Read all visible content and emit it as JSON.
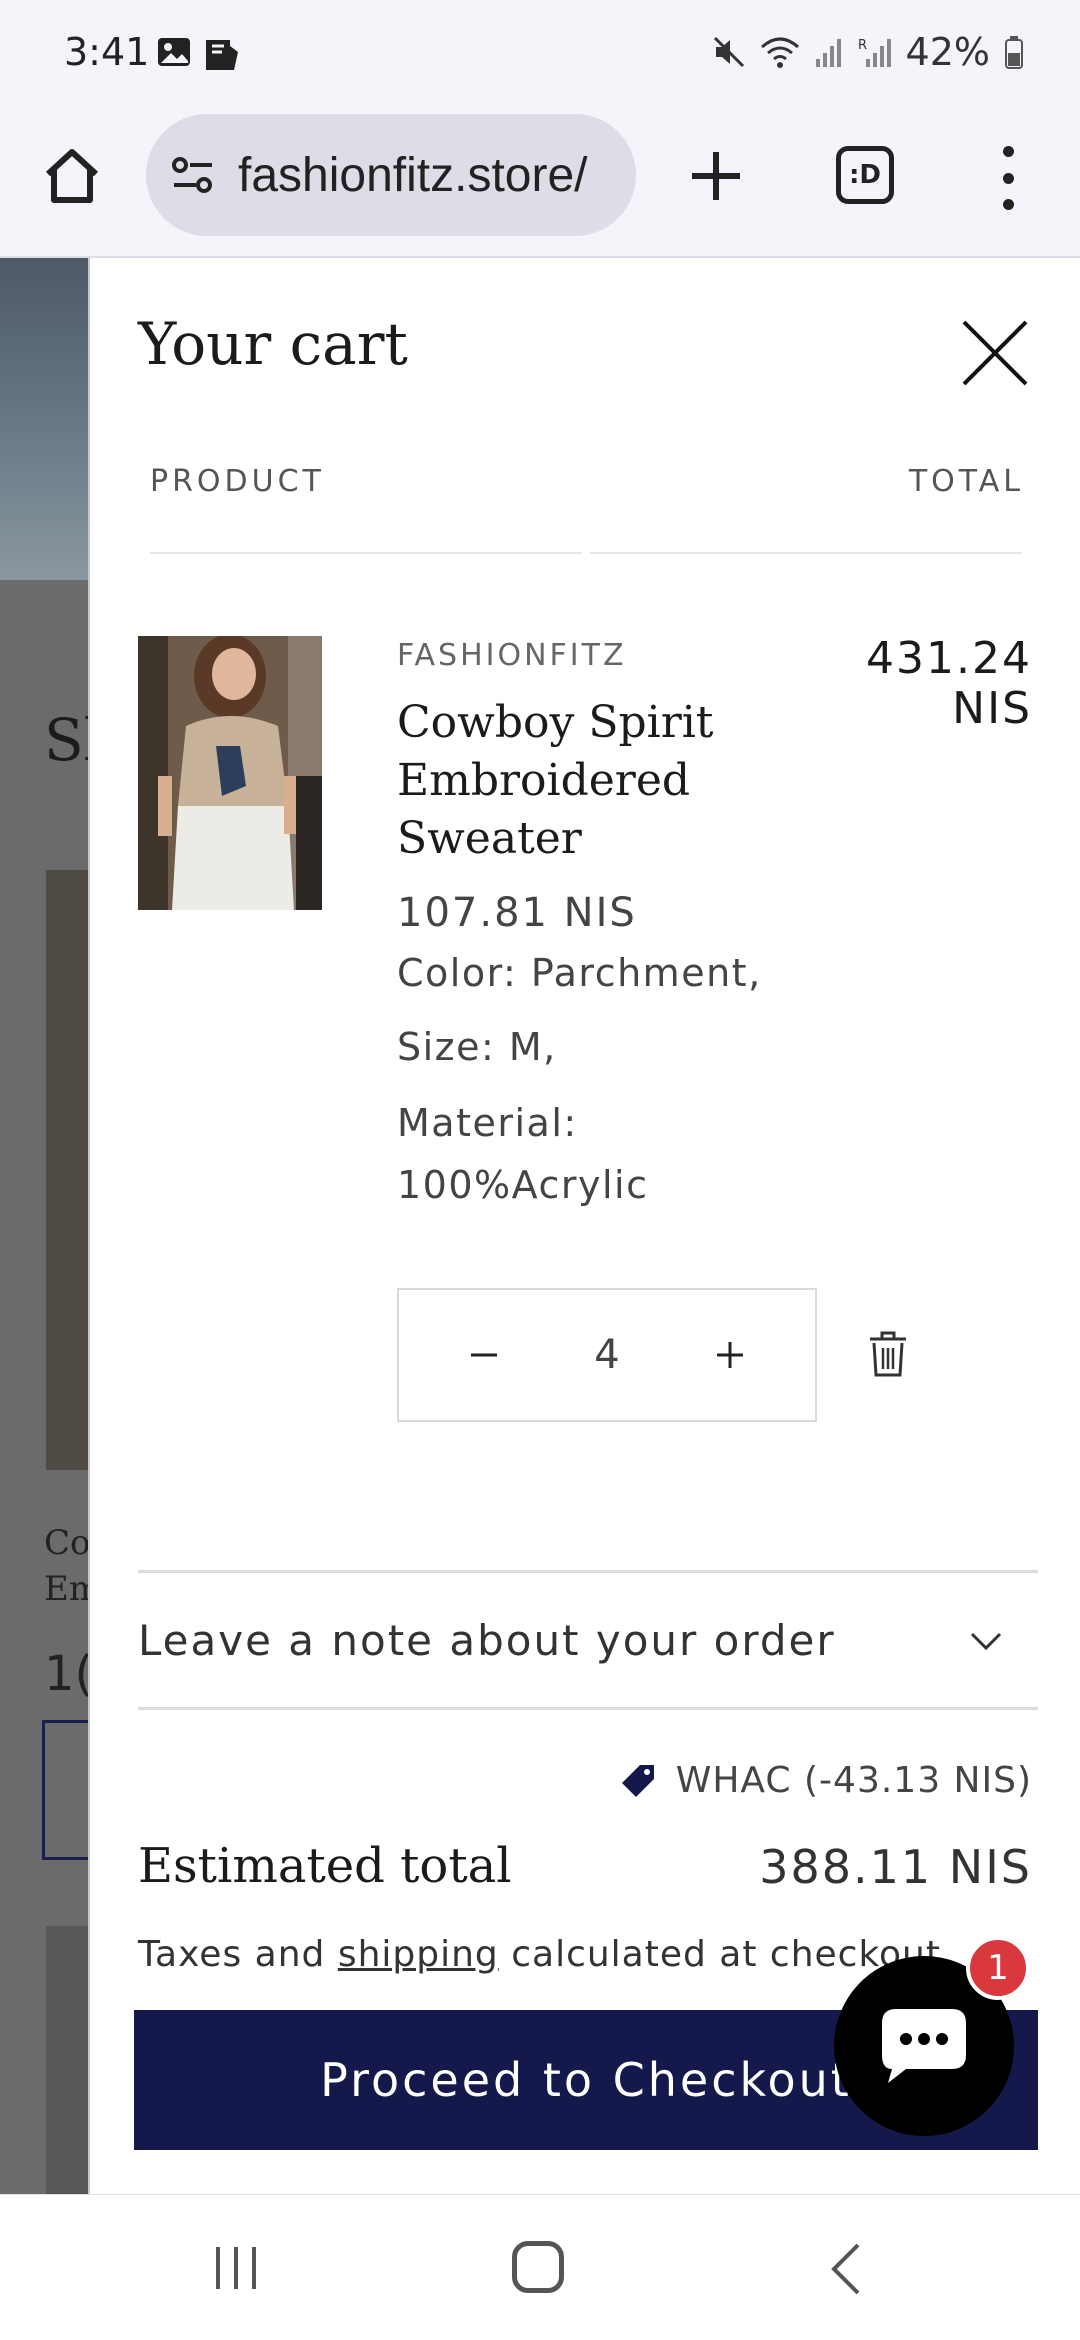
{
  "status_bar": {
    "time": "3:41",
    "battery": "42%",
    "icons": [
      "image-icon",
      "app-notification-icon",
      "mute-icon",
      "wifi-icon",
      "signal-icon",
      "signal-r-icon",
      "battery-icon"
    ]
  },
  "browser": {
    "url": "fashionfitz.store/",
    "tab_icon_label": ":D"
  },
  "background_page": {
    "heading": "Sl",
    "product_title": "Co\nEm",
    "price": "1("
  },
  "cart": {
    "title": "Your cart",
    "columns": {
      "product": "PRODUCT",
      "total": "TOTAL"
    },
    "items": [
      {
        "vendor": "FASHIONFITZ",
        "name": "Cowboy Spirit Embroidered Sweater",
        "unit_price": "107.81 NIS",
        "line_total_amount": "431.24",
        "line_total_currency": "NIS",
        "options": {
          "color": "Color: Parchment,",
          "size": "Size: M,",
          "material_label": "Material:",
          "material_value": "100%Acrylic"
        },
        "quantity": "4"
      }
    ],
    "note_label": "Leave a note about your order",
    "discount": "WHAC (-43.13 NIS)",
    "estimated_total_label": "Estimated total",
    "estimated_total_value": "388.11 NIS",
    "tax_note_prefix": "Taxes and ",
    "tax_note_link": "shipping",
    "tax_note_suffix": " calculated at checkout",
    "checkout_label": "Proceed to Checkout"
  },
  "chat": {
    "badge_count": "1"
  },
  "colors": {
    "checkout_bg": "#15184a",
    "badge": "#d9383f",
    "overlay": "#6b6b6b"
  }
}
